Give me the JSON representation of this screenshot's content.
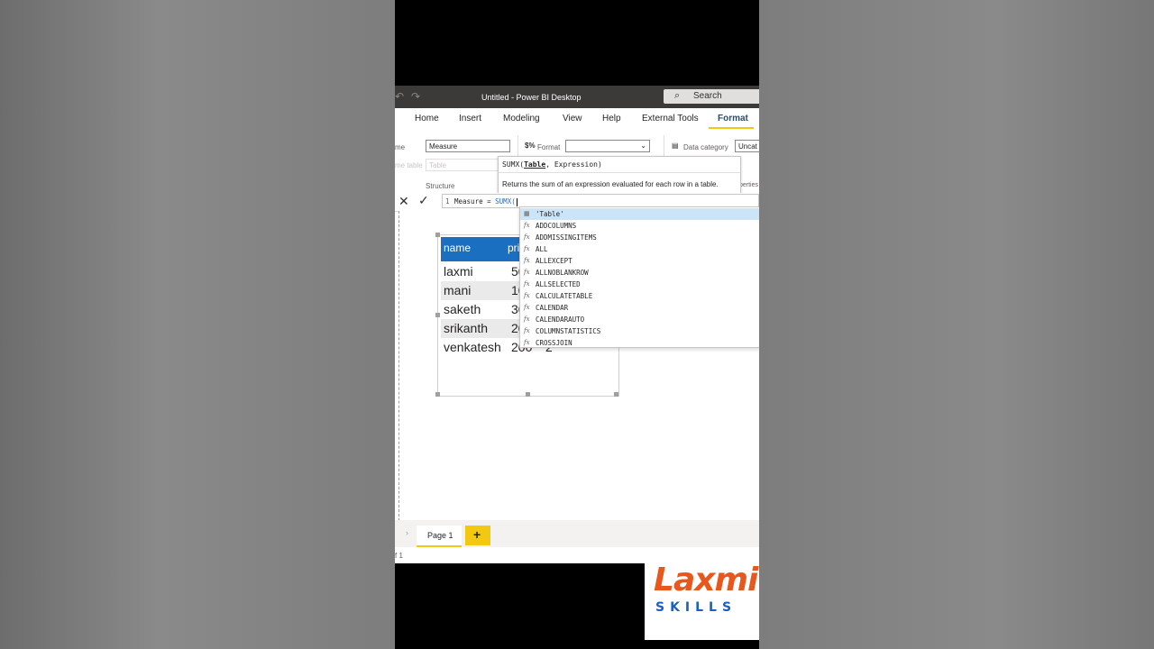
{
  "window": {
    "title": "Untitled - Power BI Desktop",
    "search_label": "Search"
  },
  "menu": {
    "items": [
      "Home",
      "Insert",
      "Modeling",
      "View",
      "Help",
      "External Tools",
      "Format"
    ],
    "active": "Format"
  },
  "ribbon": {
    "name_label": "me",
    "name_value": "Measure",
    "home_table_label": "me table",
    "home_table_value": "Table",
    "structure_label": "Structure",
    "format_label": "Format",
    "format_value": "",
    "data_category_label": "Data category",
    "data_category_value": "Uncat",
    "properties_label": "perties"
  },
  "tooltip": {
    "sig_prefix": "SUMX(",
    "sig_param": "Table",
    "sig_suffix": ", Expression)",
    "description": "Returns the sum of an expression evaluated for each row in a table."
  },
  "formula_bar": {
    "line_number": "1",
    "text_prefix": "Measure = ",
    "function_text": "SUMX("
  },
  "table_visual": {
    "columns": [
      "name",
      "pri"
    ],
    "rows": [
      {
        "name": "laxmi",
        "price": "50"
      },
      {
        "name": "mani",
        "price": "10"
      },
      {
        "name": "saketh",
        "price": "30"
      },
      {
        "name": "srikanth",
        "price": "20"
      },
      {
        "name": "venkatesh",
        "price": "200",
        "extra": "2"
      }
    ]
  },
  "autocomplete": {
    "items": [
      {
        "icon": "table-icon",
        "label": "'Table'"
      },
      {
        "icon": "function-icon",
        "label": "ADDCOLUMNS"
      },
      {
        "icon": "function-icon",
        "label": "ADDMISSINGITEMS"
      },
      {
        "icon": "function-icon",
        "label": "ALL"
      },
      {
        "icon": "function-icon",
        "label": "ALLEXCEPT"
      },
      {
        "icon": "function-icon",
        "label": "ALLNOBLANKROW"
      },
      {
        "icon": "function-icon",
        "label": "ALLSELECTED"
      },
      {
        "icon": "function-icon",
        "label": "CALCULATETABLE"
      },
      {
        "icon": "function-icon",
        "label": "CALENDAR"
      },
      {
        "icon": "function-icon",
        "label": "CALENDARAUTO"
      },
      {
        "icon": "function-icon",
        "label": "COLUMNSTATISTICS"
      },
      {
        "icon": "function-icon",
        "label": "CROSSJOIN"
      }
    ]
  },
  "pages": {
    "tabs": [
      "Page 1"
    ],
    "add_label": "+",
    "status": "f 1"
  },
  "logo": {
    "line1": "Laxmi",
    "line2": "SKILLS"
  },
  "colors": {
    "accent": "#f2c811",
    "header_blue": "#1b6fc0",
    "logo_orange": "#e8581c",
    "logo_blue": "#1b5fc2"
  }
}
